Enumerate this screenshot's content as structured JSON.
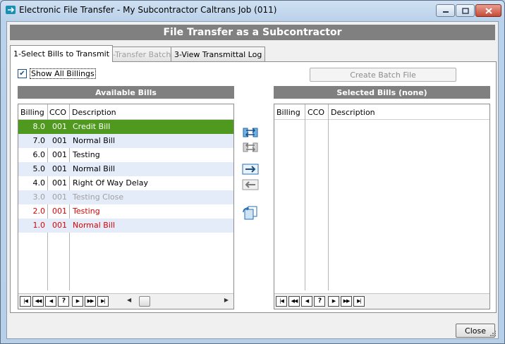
{
  "window": {
    "title": "Electronic File Transfer - My Subcontractor Caltrans Job (011)",
    "icons": {
      "app": "app-icon",
      "minimize": "minimize-icon",
      "maximize": "maximize-icon",
      "close": "close-icon"
    }
  },
  "header": {
    "title": "File Transfer as a Subcontractor"
  },
  "tabs": [
    {
      "label": "1-Select Bills to Transmit",
      "state": "active"
    },
    {
      "label": "2-Transfer Batch",
      "state": "disabled"
    },
    {
      "label": "3-View Transmittal Log",
      "state": "normal"
    }
  ],
  "controls": {
    "show_all_label": "Show All Billings",
    "show_all_checked": true,
    "create_batch_label": "Create Batch File",
    "close_label": "Close"
  },
  "available": {
    "title": "Available Bills",
    "columns": [
      "Billing",
      "CCO",
      "Description"
    ],
    "rows": [
      {
        "billing": "8.0",
        "cco": "001",
        "description": "Credit Bill",
        "style": "selected"
      },
      {
        "billing": "7.0",
        "cco": "001",
        "description": "Normal Bill",
        "style": "normal"
      },
      {
        "billing": "6.0",
        "cco": "001",
        "description": "Testing",
        "style": "normal"
      },
      {
        "billing": "5.0",
        "cco": "001",
        "description": "Normal Bill",
        "style": "normal"
      },
      {
        "billing": "4.0",
        "cco": "001",
        "description": "Right Of Way Delay",
        "style": "normal"
      },
      {
        "billing": "3.0",
        "cco": "001",
        "description": "Testing Close",
        "style": "grey"
      },
      {
        "billing": "2.0",
        "cco": "001",
        "description": "Testing",
        "style": "red"
      },
      {
        "billing": "1.0",
        "cco": "001",
        "description": "Normal Bill",
        "style": "red"
      }
    ]
  },
  "selected": {
    "title": "Selected Bills (none)",
    "columns": [
      "Billing",
      "CCO",
      "Description"
    ],
    "rows": []
  },
  "navigator": {
    "help_label": "?"
  },
  "transfer_icons": [
    "move-all-right-icon",
    "move-all-left-icon",
    "move-right-icon",
    "move-left-icon",
    "copy-icon"
  ],
  "colors": {
    "selected_row": "#4f9a1e",
    "alt_row": "#e3ecf8",
    "grey_text": "#a0a0a0",
    "red_text": "#e00000",
    "header_bar": "#808080"
  }
}
